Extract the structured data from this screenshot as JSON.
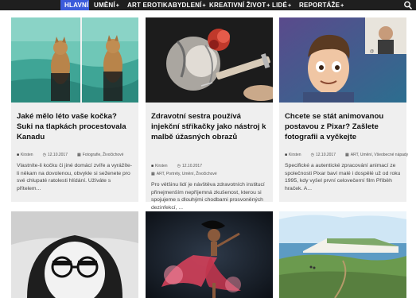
{
  "nav": {
    "items": [
      {
        "label": "HLAVNÍ",
        "plus": ""
      },
      {
        "label": "UMĚNÍ",
        "plus": "+"
      },
      {
        "label": "ART EROTIKA",
        "plus": ""
      },
      {
        "label": "BYDLENÍ",
        "plus": "+"
      },
      {
        "label": "KREATIVNÍ ŽIVOT",
        "plus": "+"
      },
      {
        "label": "LIDÉ",
        "plus": "+"
      },
      {
        "label": "REPORTÁŽE",
        "plus": "+"
      }
    ],
    "search_icon": "search-icon",
    "accent": "#3b5bdb"
  },
  "cards": [
    {
      "title": "Jaké mělo léto vaše kočka? Suki na tlapkách procestovala Kanadu",
      "author": "Kirsten",
      "date": "12.10.2017",
      "categories": "Fotografie, Živočichové",
      "excerpt": "Vlastníte-li kočku či jiné domácí zvíře a vyrážíte-li někam na dovolenou, obvykle si seženete pro své chlupaté ratolesti hlídání. Užíváte s přítelem...",
      "image": "cat-on-lake"
    },
    {
      "title": "Zdravotní sestra používá injekční stříkačky jako nástroj k malbě úžasných obrazů",
      "author": "Kirsten",
      "date": "12.10.2017",
      "categories": "ART, Portréty, Umění, Živočichové",
      "excerpt": "Pro většinu lidí je návštěva zdravotních institucí přinejmenším nepříjemná zkušenost, kterou si spojujeme s dlouhými chodbami prosvoněných dezinfekcí, ...",
      "image": "syringe-painting"
    },
    {
      "title": "Chcete se stát animovanou postavou z Pixar? Zašlete fotografii a vyčkejte",
      "author": "Kirsten",
      "date": "12.10.2017",
      "categories": "ART, Umění, Všeobecné nápady",
      "excerpt": "Specifické a autentické zpracování animací ze společnosti Pixar baví malé i dospělé už od roku 1995, kdy vyšel první celovečerní film Příběh hraček. A...",
      "image": "pixar-portrait"
    }
  ],
  "bottom_images": [
    "sketch-woman-glasses",
    "red-dress-dancer",
    "white-cliffs-coast"
  ]
}
